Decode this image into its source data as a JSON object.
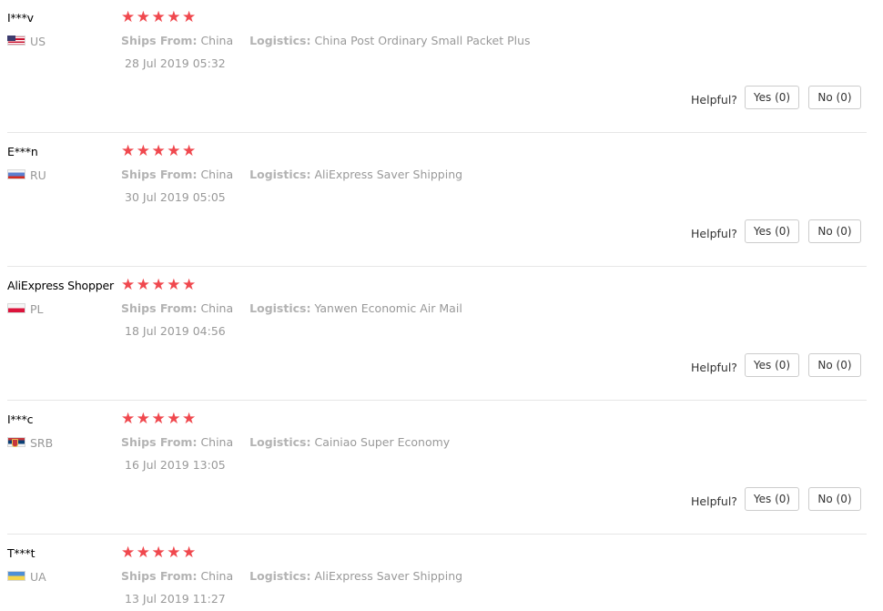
{
  "reviews": [
    {
      "user": "I***v",
      "flag": "us-flag",
      "country": "US",
      "stars": "★★★★★",
      "rating": 5,
      "ships_label": "Ships From:",
      "ships_value": "China",
      "logistics_label": "Logistics:",
      "logistics_value": "China Post Ordinary Small Packet Plus",
      "date": "28 Jul 2019 05:32",
      "helpful_label": "Helpful?",
      "yes_label": "Yes (0)",
      "no_label": "No (0)"
    },
    {
      "user": "E***n",
      "flag": "ru-flag",
      "country": "RU",
      "stars": "★★★★★",
      "rating": 5,
      "ships_label": "Ships From:",
      "ships_value": "China",
      "logistics_label": "Logistics:",
      "logistics_value": "AliExpress Saver Shipping",
      "date": "30 Jul 2019 05:05",
      "helpful_label": "Helpful?",
      "yes_label": "Yes (0)",
      "no_label": "No (0)"
    },
    {
      "user": "AliExpress Shopper",
      "flag": "pl-flag",
      "country": "PL",
      "stars": "★★★★★",
      "rating": 5,
      "ships_label": "Ships From:",
      "ships_value": "China",
      "logistics_label": "Logistics:",
      "logistics_value": "Yanwen Economic Air Mail",
      "date": "18 Jul 2019 04:56",
      "helpful_label": "Helpful?",
      "yes_label": "Yes (0)",
      "no_label": "No (0)"
    },
    {
      "user": "I***c",
      "flag": "srb-flag",
      "country": "SRB",
      "stars": "★★★★★",
      "rating": 5,
      "ships_label": "Ships From:",
      "ships_value": "China",
      "logistics_label": "Logistics:",
      "logistics_value": "Cainiao Super Economy",
      "date": "16 Jul 2019 13:05",
      "helpful_label": "Helpful?",
      "yes_label": "Yes (0)",
      "no_label": "No (0)"
    },
    {
      "user": "T***t",
      "flag": "ua-flag",
      "country": "UA",
      "stars": "★★★★★",
      "rating": 5,
      "ships_label": "Ships From:",
      "ships_value": "China",
      "logistics_label": "Logistics:",
      "logistics_value": "AliExpress Saver Shipping",
      "date": "13 Jul 2019 11:27"
    }
  ],
  "colors": {
    "star": "#f0484e",
    "muted_text": "#999999",
    "separator": "#e6e6e6"
  }
}
